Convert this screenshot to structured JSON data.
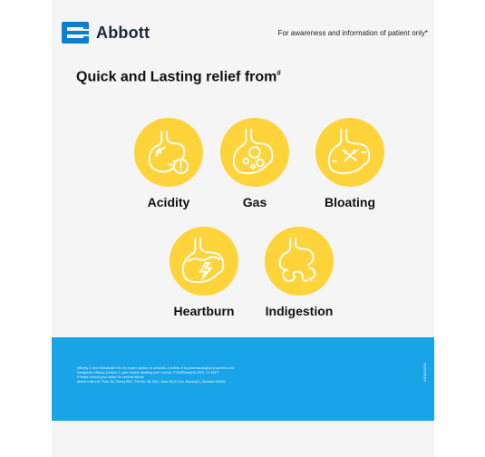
{
  "brand": {
    "name": "Abbott",
    "color": "#0a7fd1"
  },
  "header": {
    "awareness_text": "For awareness and information of patient only*"
  },
  "headline": {
    "text": "Quick and Lasting relief from",
    "mark": "#"
  },
  "symptoms": [
    {
      "label": "Acidity",
      "icon": "stomach-alert-icon"
    },
    {
      "label": "Gas",
      "icon": "stomach-gas-icon"
    },
    {
      "label": "Bloating",
      "icon": "stomach-bloating-icon"
    },
    {
      "label": "Heartburn",
      "icon": "stomach-heartburn-icon"
    },
    {
      "label": "Indigestion",
      "icon": "stomach-indigestion-icon"
    }
  ],
  "colors": {
    "icon_circle": "#ffd33a",
    "footer": "#19a4e8"
  },
  "footer": {
    "lines": [
      "#Shetty G and Vishwanath KN. An expert opinion on antacids. A review of its pharmacological properties and",
      "therapeutic efficacy [version 1; peer review: awaiting peer review]. F1000Research 2023, 12:1057*",
      "*Please consult your doctor for medical advice",
      "Abbott India Ltd. Floor 16, Godrej BKC, Plot No. 68, BKC, Near MCA Club, Bandra(E), Mumbai 400051"
    ],
    "code": "INDDIG0001"
  }
}
